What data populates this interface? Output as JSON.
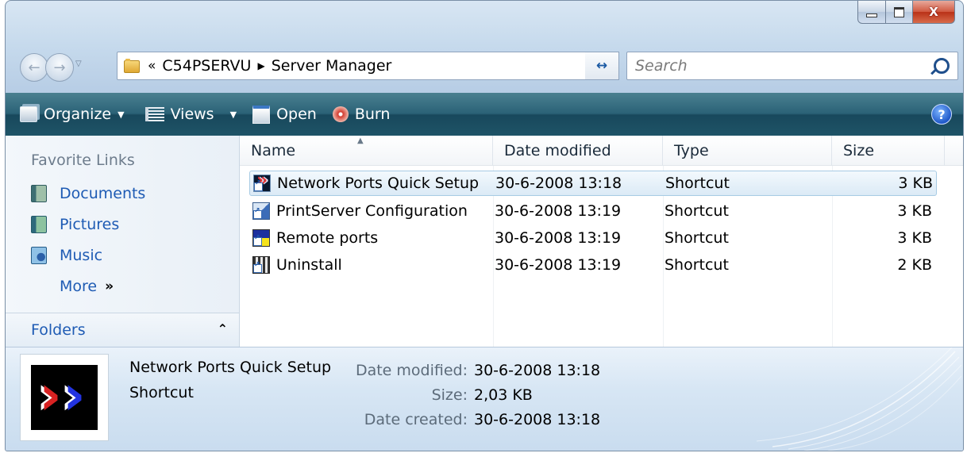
{
  "window": {
    "caption": {
      "minimize": "–",
      "maximize": "□",
      "close": "X"
    }
  },
  "address": {
    "overflow": "«",
    "path": [
      "C54PSERVU",
      "Server Manager"
    ],
    "separator": "▶",
    "dropdown": "▼"
  },
  "search": {
    "placeholder": "Search"
  },
  "toolbar": {
    "organize": "Organize",
    "views": "Views",
    "open": "Open",
    "burn": "Burn",
    "help": "?"
  },
  "nav": {
    "favorites_title": "Favorite Links",
    "items": [
      {
        "label": "Documents",
        "icon": "documents-icon"
      },
      {
        "label": "Pictures",
        "icon": "pictures-icon"
      },
      {
        "label": "Music",
        "icon": "music-icon"
      }
    ],
    "more": "More",
    "folders": "Folders"
  },
  "columns": {
    "name": "Name",
    "date": "Date modified",
    "type": "Type",
    "size": "Size"
  },
  "files": [
    {
      "name": "Network Ports Quick Setup",
      "date": "30-6-2008 13:18",
      "type": "Shortcut",
      "size": "3 KB",
      "selected": true
    },
    {
      "name": "PrintServer Configuration",
      "date": "30-6-2008 13:19",
      "type": "Shortcut",
      "size": "3 KB"
    },
    {
      "name": "Remote ports",
      "date": "30-6-2008 13:19",
      "type": "Shortcut",
      "size": "3 KB"
    },
    {
      "name": "Uninstall",
      "date": "30-6-2008 13:19",
      "type": "Shortcut",
      "size": "2 KB"
    }
  ],
  "details": {
    "name": "Network Ports Quick Setup",
    "type": "Shortcut",
    "modified_label": "Date modified:",
    "modified_value": "30-6-2008 13:18",
    "size_label": "Size:",
    "size_value": "2,03 KB",
    "created_label": "Date created:",
    "created_value": "30-6-2008 13:18"
  }
}
